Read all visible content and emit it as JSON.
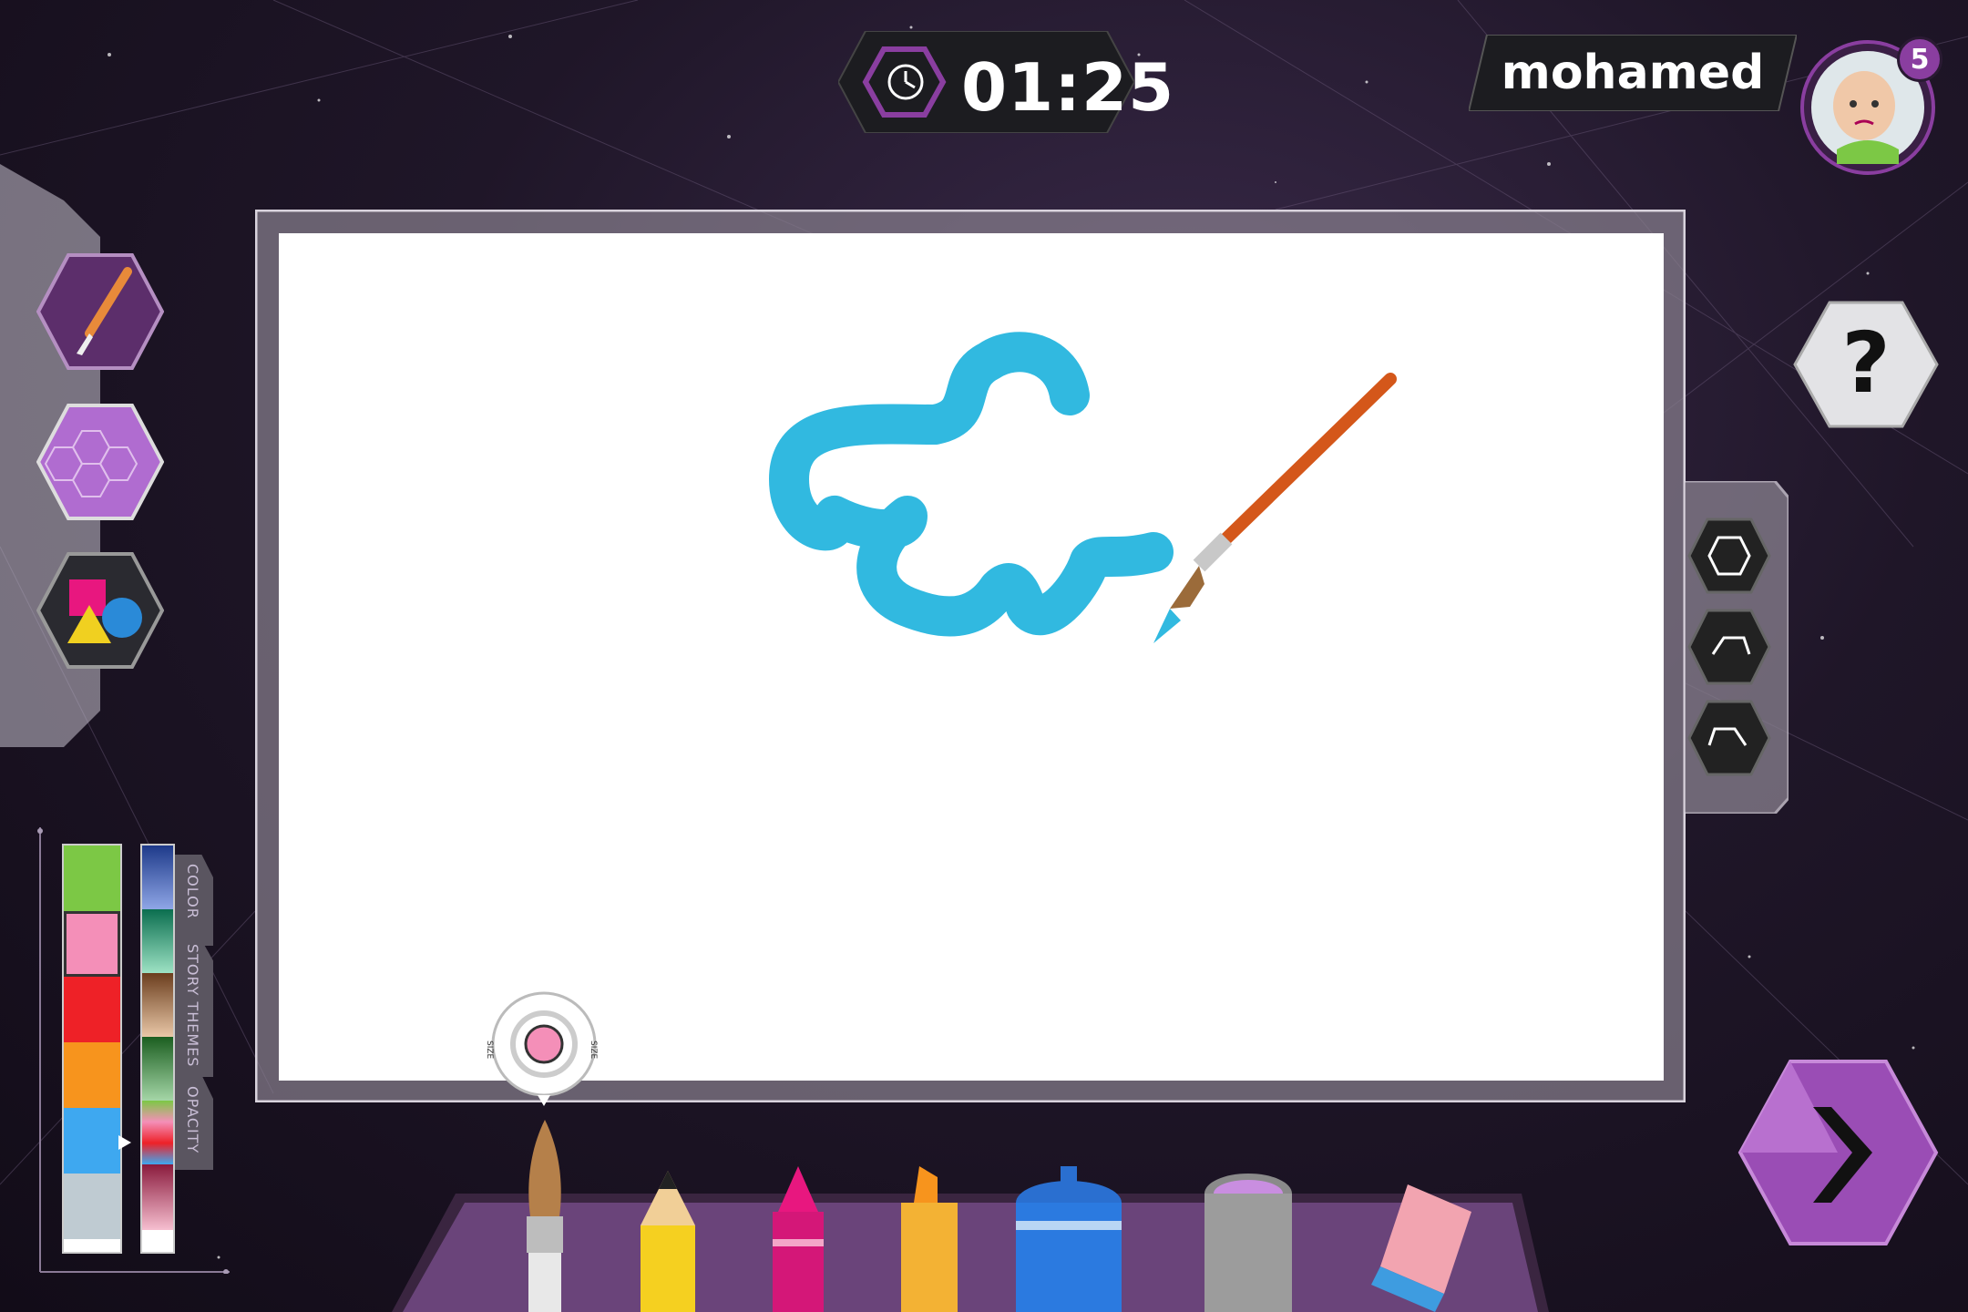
{
  "timer": {
    "time": "01:25"
  },
  "user": {
    "name": "mohamed",
    "notifications": "5"
  },
  "left_tools": [
    {
      "icon": "paintbrush-icon"
    },
    {
      "icon": "pattern-icon"
    },
    {
      "icon": "shapes-icon"
    }
  ],
  "right_tools": [
    {
      "icon": "clear-canvas-icon"
    },
    {
      "icon": "undo-icon"
    },
    {
      "icon": "redo-icon"
    }
  ],
  "help": {
    "icon": "question-icon",
    "label": "?"
  },
  "next": {
    "icon": "next-arrow-icon"
  },
  "palette": {
    "tabs": [
      "COLOR",
      "STORY THEMES",
      "OPACITY"
    ],
    "selected_color": "#f48fb8",
    "swatches": [
      "#7cc845",
      "#f48fb8",
      "#ee2127",
      "#f7941d",
      "#3ea8f0",
      "#bfcbd2"
    ],
    "size_labels": [
      "SIZE",
      "SIZE"
    ]
  },
  "drawing_tools": [
    {
      "icon": "paintbrush-tool-icon"
    },
    {
      "icon": "pencil-tool-icon"
    },
    {
      "icon": "crayon-tool-icon"
    },
    {
      "icon": "highlighter-tool-icon"
    },
    {
      "icon": "spray-can-tool-icon"
    },
    {
      "icon": "paint-bucket-tool-icon"
    },
    {
      "icon": "eraser-tool-icon"
    }
  ],
  "colors": {
    "stroke": "#31b9e0",
    "accent": "#8a3ea0"
  }
}
